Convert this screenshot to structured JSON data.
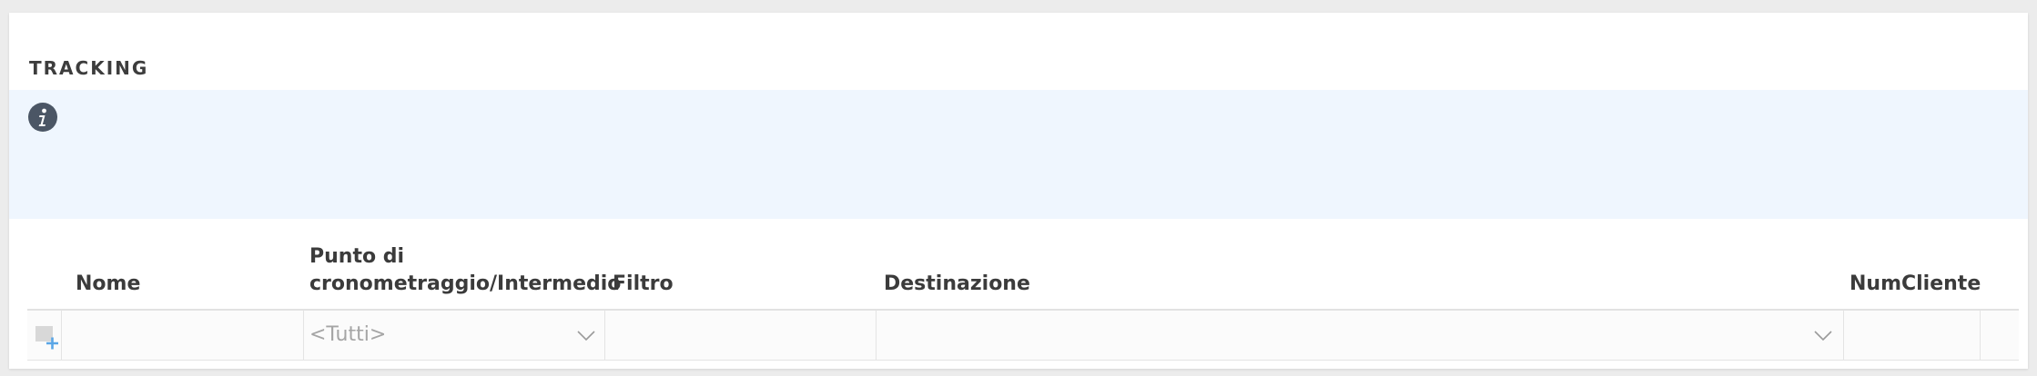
{
  "panel": {
    "title": "TRACKING"
  },
  "info": {
    "icon": "info-icon"
  },
  "grid": {
    "columns": [
      {
        "key": "nome",
        "label": "Nome"
      },
      {
        "key": "punto",
        "label": "Punto di cronometraggio/Intermedio"
      },
      {
        "key": "filtro",
        "label": "Filtro"
      },
      {
        "key": "destinazione",
        "label": "Destinazione"
      },
      {
        "key": "numcliente",
        "label": "NumCliente"
      }
    ],
    "filter_row": {
      "add_icon": "add-row-icon",
      "punto_selected": "<Tutti>",
      "destinazione_selected": ""
    }
  },
  "colors": {
    "info_background": "#eff6fe",
    "info_icon": "#4b5665",
    "page_background": "#ececec"
  }
}
